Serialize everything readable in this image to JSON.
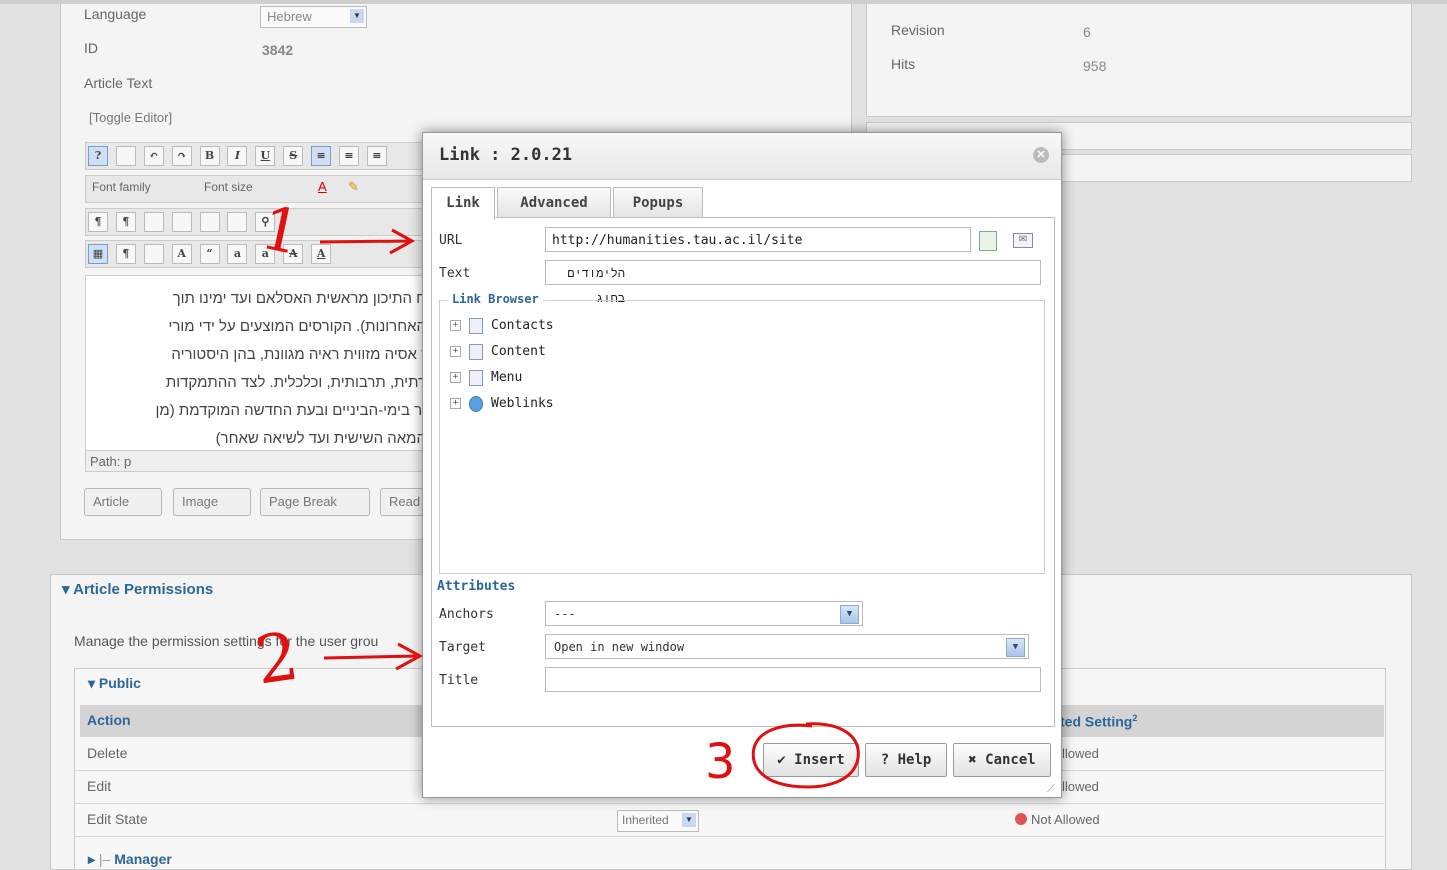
{
  "article": {
    "language_label": "Language",
    "language_value": "Hebrew",
    "id_label": "ID",
    "id_value": "3842",
    "text_label": "Article Text",
    "toggle_editor": "[Toggle Editor]",
    "font_family": "Font family",
    "font_size": "Font size",
    "body_lines": [
      "ח התיכון מראשית האסלאם ועד ימינו תוך",
      "האחרונות). הקורסים המוצעים על ידי מורי",
      "ז אסיה מזווית ראיה מגוונת, בהן היסטוריה",
      "רתית, תרבותית, וכלכלית. לצד ההתמקדות",
      "ור בימי-הביניים ובעת החדשה המוקדמת (מן",
      "המאה השישית ועד לשיאה שאחר)"
    ],
    "path_label": "Path:",
    "path_value": "p",
    "buttons": [
      "Article",
      "Image",
      "Page Break",
      "Read"
    ]
  },
  "info": {
    "revision_label": "Revision",
    "revision_value": "6",
    "hits_label": "Hits",
    "hits_value": "958"
  },
  "permissions": {
    "title": "Article Permissions",
    "description": "Manage the permission settings for the user grou",
    "public_label": "Public",
    "action_header": "Action",
    "calc_header": "ted Setting",
    "calc_sup": "2",
    "rows": [
      {
        "action": "Delete",
        "select": "",
        "calc": "llowed"
      },
      {
        "action": "Edit",
        "select": "",
        "calc": "llowed"
      },
      {
        "action": "Edit State",
        "select": "Inherited",
        "calc": "Not Allowed"
      }
    ],
    "manager_label": "Manager"
  },
  "dialog": {
    "title": "Link : 2.0.21",
    "tabs": [
      "Link",
      "Advanced",
      "Popups"
    ],
    "url_label": "URL",
    "url_value": "http://humanities.tau.ac.il/site",
    "text_label": "Text",
    "text_value": "הלימודים בחוג",
    "browser_legend": "Link Browser",
    "tree": [
      "Contacts",
      "Content",
      "Menu",
      "Weblinks"
    ],
    "attributes_label": "Attributes",
    "anchors_label": "Anchors",
    "anchors_value": "---",
    "target_label": "Target",
    "target_value": "Open in new window",
    "title_label": "Title",
    "title_value": "",
    "insert_label": "Insert",
    "help_label": "Help",
    "cancel_label": "Cancel"
  },
  "annotations": [
    "1",
    "2",
    "3"
  ],
  "colors": {
    "link_blue": "#2d6699",
    "annotation_red": "#e01010",
    "dialog_bg": "#ffffff"
  }
}
